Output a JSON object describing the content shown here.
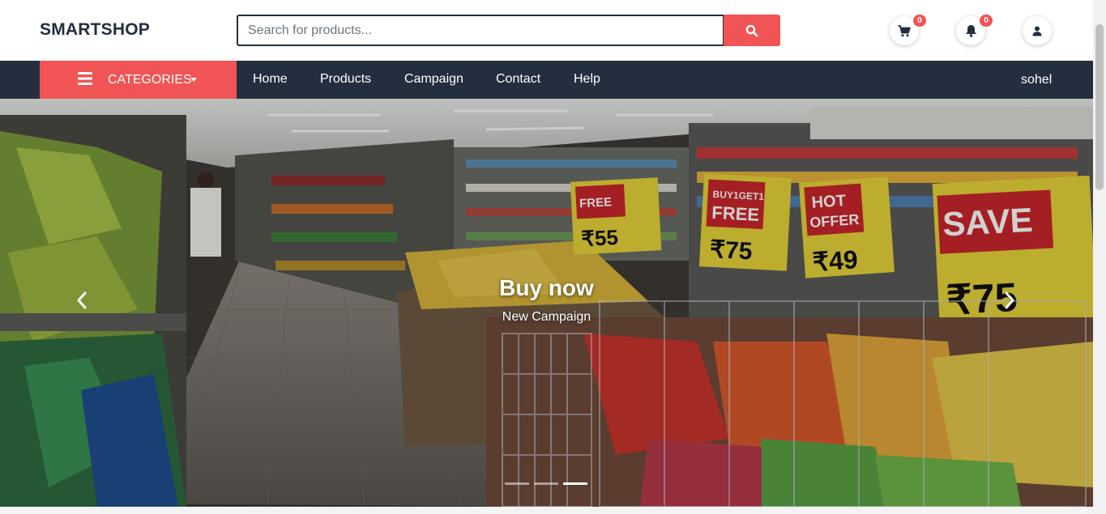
{
  "brand": {
    "name": "SMARTSHOP",
    "accent": "#f05454",
    "dark": "#232f3e"
  },
  "search": {
    "placeholder": "Search for products...",
    "value": "",
    "button_icon": "search-icon"
  },
  "header_icons": {
    "cart": {
      "icon": "cart-icon",
      "count": "0"
    },
    "notifications": {
      "icon": "bell-icon",
      "count": "0"
    },
    "account": {
      "icon": "user-icon"
    }
  },
  "nav": {
    "categories_label": "CATEGORIES",
    "links": [
      "Home",
      "Products",
      "Campaign",
      "Contact",
      "Help"
    ],
    "user": "sohel"
  },
  "hero": {
    "title": "Buy now",
    "subtitle": "New Campaign",
    "slides": 3,
    "active_slide": 3,
    "background": "supermarket aisle with snack shelves",
    "sign_texts": [
      "BUY1GET1 FREE",
      "HOT OFFER",
      "SAVE"
    ]
  }
}
